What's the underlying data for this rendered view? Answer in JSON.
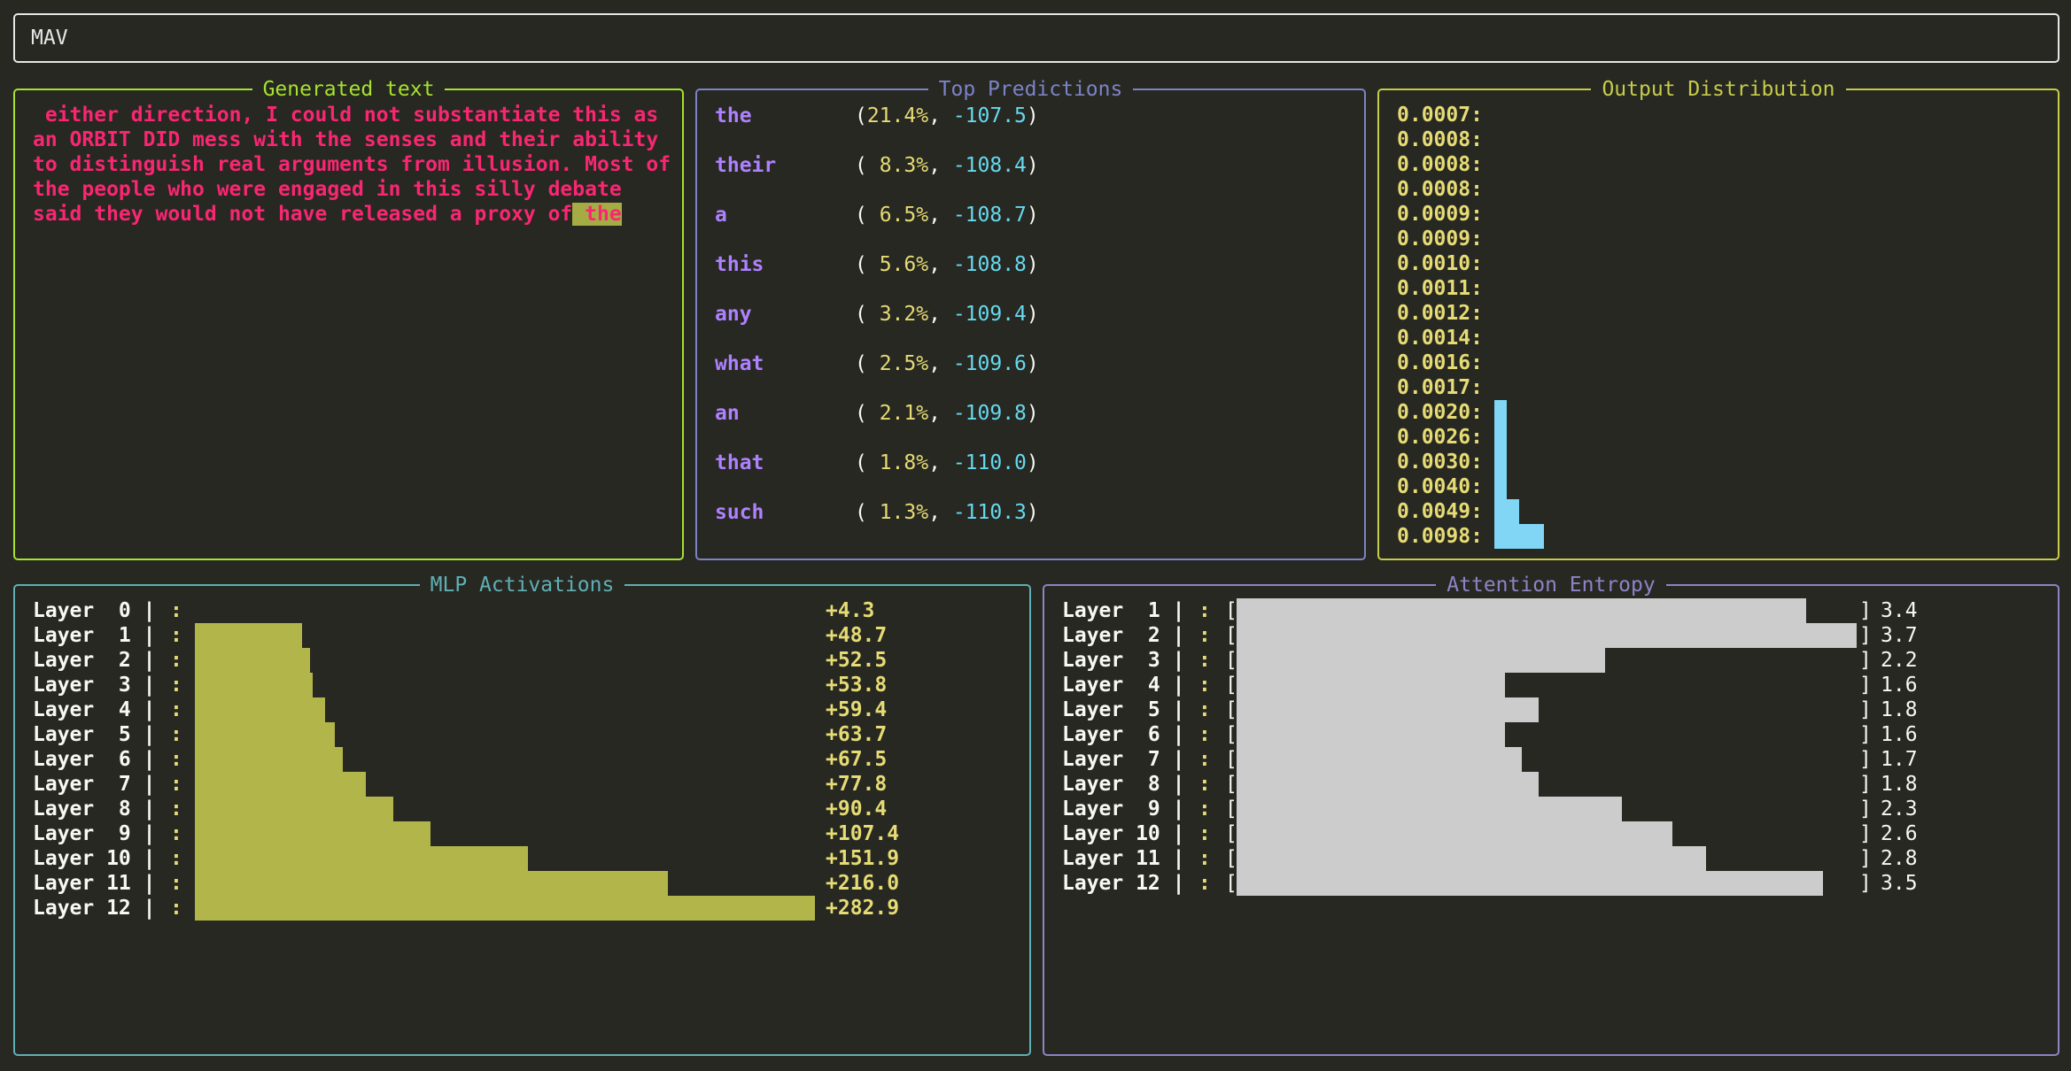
{
  "header": {
    "title": "MAV"
  },
  "generated": {
    "title": "Generated text",
    "text": " either direction, I could not substantiate this as an ORBIT DID mess with the senses and their ability to distinguish real arguments from illusion. Most of the people who were engaged in this silly debate said they would not have released a proxy of",
    "current_token": " the"
  },
  "predictions": {
    "title": "Top Predictions",
    "rows": [
      {
        "token": "the",
        "pct": "21.4%",
        "logit": "-107.5"
      },
      {
        "token": "their",
        "pct": " 8.3%",
        "logit": "-108.4"
      },
      {
        "token": "a",
        "pct": " 6.5%",
        "logit": "-108.7"
      },
      {
        "token": "this",
        "pct": " 5.6%",
        "logit": "-108.8"
      },
      {
        "token": "any",
        "pct": " 3.2%",
        "logit": "-109.4"
      },
      {
        "token": "what",
        "pct": " 2.5%",
        "logit": "-109.6"
      },
      {
        "token": "an",
        "pct": " 2.1%",
        "logit": "-109.8"
      },
      {
        "token": "that",
        "pct": " 1.8%",
        "logit": "-110.0"
      },
      {
        "token": "such",
        "pct": " 1.3%",
        "logit": "-110.3"
      }
    ]
  },
  "distribution": {
    "title": "Output Distribution",
    "rows": [
      {
        "label": "0.0007:",
        "level": 0
      },
      {
        "label": "0.0008:",
        "level": 0
      },
      {
        "label": "0.0008:",
        "level": 0
      },
      {
        "label": "0.0008:",
        "level": 0
      },
      {
        "label": "0.0009:",
        "level": 0
      },
      {
        "label": "0.0009:",
        "level": 0
      },
      {
        "label": "0.0010:",
        "level": 0
      },
      {
        "label": "0.0011:",
        "level": 0
      },
      {
        "label": "0.0012:",
        "level": 0
      },
      {
        "label": "0.0014:",
        "level": 0
      },
      {
        "label": "0.0016:",
        "level": 0
      },
      {
        "label": "0.0017:",
        "level": 0
      },
      {
        "label": "0.0020:",
        "level": 1
      },
      {
        "label": "0.0026:",
        "level": 1
      },
      {
        "label": "0.0030:",
        "level": 1
      },
      {
        "label": "0.0040:",
        "level": 1
      },
      {
        "label": "0.0049:",
        "level": 2
      },
      {
        "label": "0.0098:",
        "level": 4
      }
    ],
    "bar_color": "#80d6f4"
  },
  "mlp": {
    "title": "MLP Activations",
    "max_value": 282.9,
    "rows": [
      {
        "layer": "Layer  0 |",
        "value": 4.3,
        "label": "+4.3"
      },
      {
        "layer": "Layer  1 |",
        "value": 48.7,
        "label": "+48.7"
      },
      {
        "layer": "Layer  2 |",
        "value": 52.5,
        "label": "+52.5"
      },
      {
        "layer": "Layer  3 |",
        "value": 53.8,
        "label": "+53.8"
      },
      {
        "layer": "Layer  4 |",
        "value": 59.4,
        "label": "+59.4"
      },
      {
        "layer": "Layer  5 |",
        "value": 63.7,
        "label": "+63.7"
      },
      {
        "layer": "Layer  6 |",
        "value": 67.5,
        "label": "+67.5"
      },
      {
        "layer": "Layer  7 |",
        "value": 77.8,
        "label": "+77.8"
      },
      {
        "layer": "Layer  8 |",
        "value": 90.4,
        "label": "+90.4"
      },
      {
        "layer": "Layer  9 |",
        "value": 107.4,
        "label": "+107.4"
      },
      {
        "layer": "Layer 10 |",
        "value": 151.9,
        "label": "+151.9"
      },
      {
        "layer": "Layer 11 |",
        "value": 216.0,
        "label": "+216.0"
      },
      {
        "layer": "Layer 12 |",
        "value": 282.9,
        "label": "+282.9"
      }
    ],
    "bar_color": "#b2b64a"
  },
  "attention": {
    "title": "Attention Entropy",
    "max_value": 3.7,
    "rows": [
      {
        "layer": "Layer  1 |",
        "value": 3.4,
        "label": "3.4"
      },
      {
        "layer": "Layer  2 |",
        "value": 3.7,
        "label": "3.7"
      },
      {
        "layer": "Layer  3 |",
        "value": 2.2,
        "label": "2.2"
      },
      {
        "layer": "Layer  4 |",
        "value": 1.6,
        "label": "1.6"
      },
      {
        "layer": "Layer  5 |",
        "value": 1.8,
        "label": "1.8"
      },
      {
        "layer": "Layer  6 |",
        "value": 1.6,
        "label": "1.6"
      },
      {
        "layer": "Layer  7 |",
        "value": 1.7,
        "label": "1.7"
      },
      {
        "layer": "Layer  8 |",
        "value": 1.8,
        "label": "1.8"
      },
      {
        "layer": "Layer  9 |",
        "value": 2.3,
        "label": "2.3"
      },
      {
        "layer": "Layer 10 |",
        "value": 2.6,
        "label": "2.6"
      },
      {
        "layer": "Layer 11 |",
        "value": 2.8,
        "label": "2.8"
      },
      {
        "layer": "Layer 12 |",
        "value": 3.5,
        "label": "3.5"
      }
    ],
    "bar_color": "#cccccc"
  }
}
